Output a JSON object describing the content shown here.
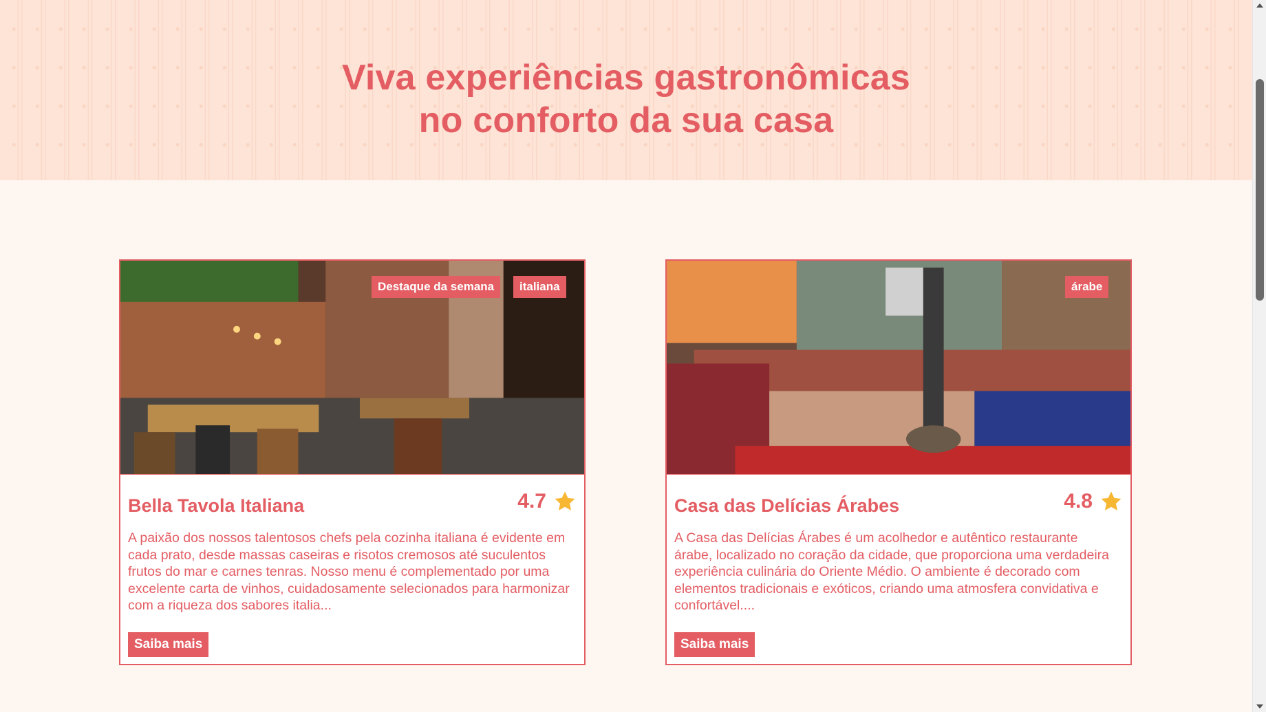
{
  "hero": {
    "title_line1": "Viva experiências gastronômicas",
    "title_line2": "no conforto da sua casa"
  },
  "cards": [
    {
      "tags": [
        "Destaque da semana",
        "italiana"
      ],
      "title": "Bella Tavola Italiana",
      "rating": "4.7",
      "description": "A paixão dos nossos talentosos chefs pela cozinha italiana é evidente em cada prato, desde massas caseiras e risotos cremosos até suculentos frutos do mar e carnes tenras. Nosso menu é complementado por uma excelente carta de vinhos, cuidadosamente selecionados para harmonizar com a riqueza dos sabores italia...",
      "button": "Saiba mais"
    },
    {
      "tags": [
        "árabe"
      ],
      "title": "Casa das Delícias Árabes",
      "rating": "4.8",
      "description": "A Casa das Delícias Árabes é um acolhedor e autêntico restaurante árabe, localizado no coração da cidade, que proporciona uma verdadeira experiência culinária do Oriente Médio. O ambiente é decorado com elementos tradicionais e exóticos, criando uma atmosfera convidativa e confortável....",
      "button": "Saiba mais"
    }
  ],
  "colors": {
    "accent": "#e35d63",
    "hero_bg": "#fde4d6",
    "page_bg": "#fdf6f1",
    "star": "#f7b733"
  }
}
